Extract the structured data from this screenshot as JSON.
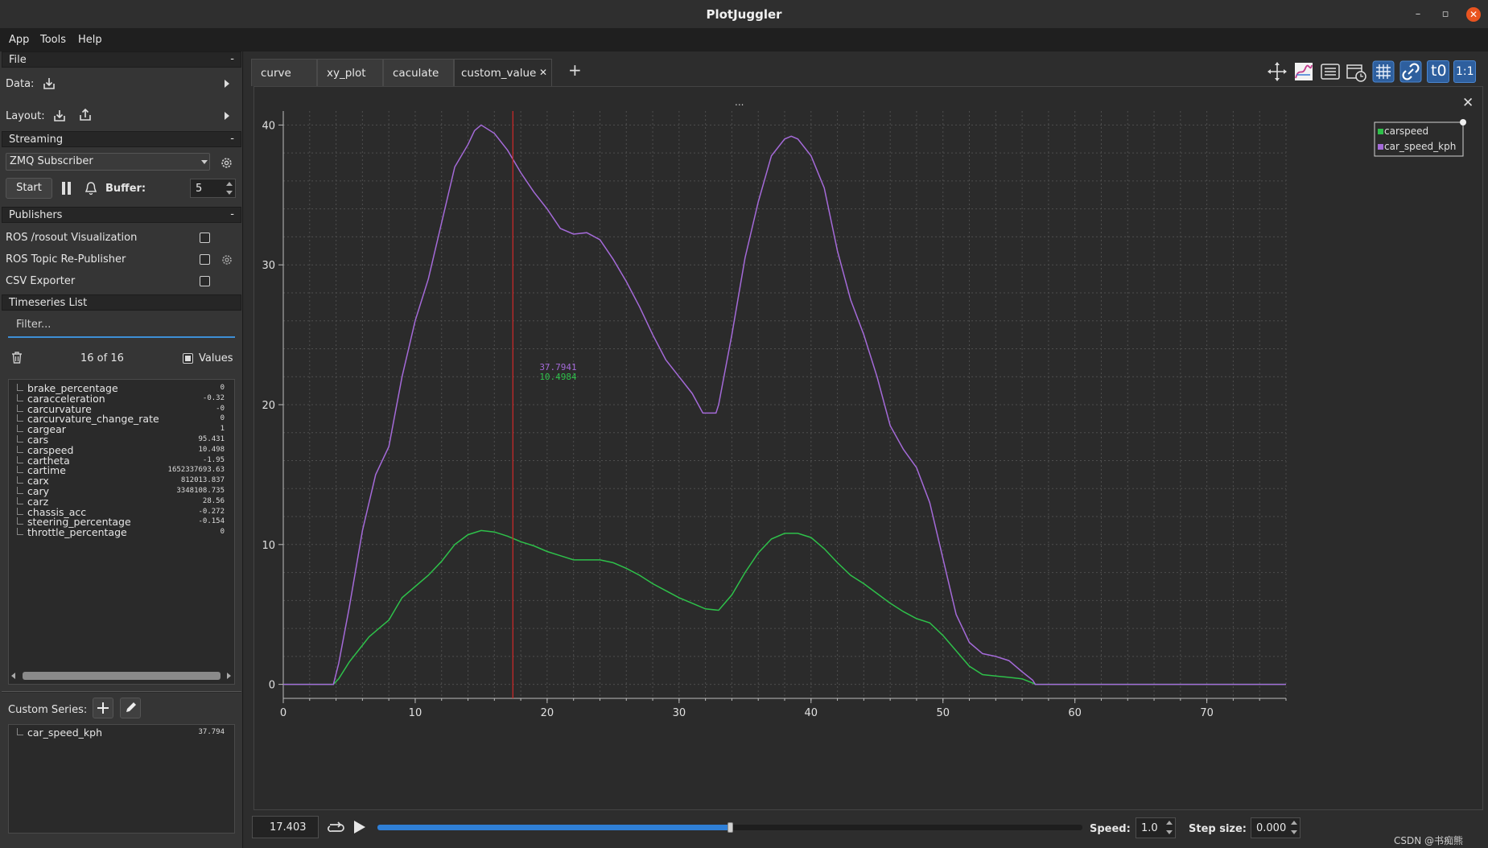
{
  "window": {
    "title": "PlotJuggler",
    "minimize": "–",
    "maximize": "▫",
    "close": "✕"
  },
  "menu": [
    "App",
    "Tools",
    "Help"
  ],
  "left": {
    "file": {
      "header": "File",
      "collapse": "-",
      "data_label": "Data:",
      "layout_label": "Layout:"
    },
    "streaming": {
      "header": "Streaming",
      "collapse": "-",
      "source": "ZMQ Subscriber",
      "start": "Start",
      "buffer_label": "Buffer:",
      "buffer_value": "5"
    },
    "publishers": {
      "header": "Publishers",
      "collapse": "-",
      "items": [
        "ROS /rosout Visualization",
        "ROS Topic Re-Publisher",
        "CSV Exporter"
      ]
    },
    "timeseries": {
      "header": "Timeseries List",
      "filter_placeholder": "Filter...",
      "count": "16 of 16",
      "values_label": "Values",
      "rows": [
        {
          "name": "brake_percentage",
          "value": "0"
        },
        {
          "name": "caracceleration",
          "value": "-0.32"
        },
        {
          "name": "carcurvature",
          "value": "-0"
        },
        {
          "name": "carcurvature_change_rate",
          "value": "0"
        },
        {
          "name": "cargear",
          "value": "1"
        },
        {
          "name": "cars",
          "value": "95.431"
        },
        {
          "name": "carspeed",
          "value": "10.498"
        },
        {
          "name": "cartheta",
          "value": "-1.95"
        },
        {
          "name": "cartime",
          "value": "1652337693.63"
        },
        {
          "name": "carx",
          "value": "812013.837"
        },
        {
          "name": "cary",
          "value": "3348108.735"
        },
        {
          "name": "carz",
          "value": "28.56"
        },
        {
          "name": "chassis_acc",
          "value": "-0.272"
        },
        {
          "name": "steering_percentage",
          "value": "-0.154"
        },
        {
          "name": "throttle_percentage",
          "value": "0"
        }
      ]
    },
    "custom": {
      "label": "Custom Series:",
      "rows": [
        {
          "name": "car_speed_kph",
          "value": "37.794"
        }
      ]
    }
  },
  "tabs": [
    {
      "label": "curve"
    },
    {
      "label": "xy_plot"
    },
    {
      "label": "caculate"
    },
    {
      "label": "custom_value",
      "active": true
    }
  ],
  "tab_close": "✕",
  "tab_add": "+",
  "toolbar_icons": [
    "move-icon",
    "edit-plot-icon",
    "list-icon",
    "clock-icon",
    "grid-icon",
    "link-icon",
    "t0-icon",
    "ratio-icon"
  ],
  "toolbar_text": {
    "t0": "t0",
    "ratio": "1:1"
  },
  "plot": {
    "title_placeholder": "...",
    "close": "✕",
    "tracker": {
      "x": 17.403,
      "v1": "37.7941",
      "v2": "10.4984"
    }
  },
  "chart_data": {
    "type": "line",
    "xlim": [
      0,
      76
    ],
    "ylim": [
      -1,
      41
    ],
    "xticks": [
      0,
      10,
      20,
      30,
      40,
      50,
      60,
      70
    ],
    "yticks": [
      0,
      10,
      20,
      30,
      40
    ],
    "grid": true,
    "legend_position": "top-right",
    "series": [
      {
        "name": "carspeed",
        "color": "#2ec04a",
        "points": [
          [
            0,
            0
          ],
          [
            3.8,
            0
          ],
          [
            4.2,
            0.4
          ],
          [
            5,
            1.6
          ],
          [
            6,
            2.8
          ],
          [
            6.5,
            3.4
          ],
          [
            7.5,
            4.2
          ],
          [
            8,
            4.6
          ],
          [
            8.5,
            5.4
          ],
          [
            9,
            6.2
          ],
          [
            10,
            7.0
          ],
          [
            11,
            7.8
          ],
          [
            12,
            8.8
          ],
          [
            13,
            10.0
          ],
          [
            14,
            10.7
          ],
          [
            15,
            11.0
          ],
          [
            16,
            10.9
          ],
          [
            17,
            10.6
          ],
          [
            18,
            10.2
          ],
          [
            19,
            9.9
          ],
          [
            20,
            9.5
          ],
          [
            21,
            9.2
          ],
          [
            22,
            8.9
          ],
          [
            23,
            8.9
          ],
          [
            24,
            8.9
          ],
          [
            25,
            8.7
          ],
          [
            26,
            8.3
          ],
          [
            27,
            7.8
          ],
          [
            28,
            7.2
          ],
          [
            29,
            6.7
          ],
          [
            30,
            6.2
          ],
          [
            31,
            5.8
          ],
          [
            32,
            5.4
          ],
          [
            33,
            5.3
          ],
          [
            34,
            6.4
          ],
          [
            35,
            8.0
          ],
          [
            36,
            9.4
          ],
          [
            37,
            10.4
          ],
          [
            38,
            10.8
          ],
          [
            39,
            10.8
          ],
          [
            40,
            10.5
          ],
          [
            41,
            9.7
          ],
          [
            42,
            8.7
          ],
          [
            43,
            7.8
          ],
          [
            44,
            7.2
          ],
          [
            45,
            6.5
          ],
          [
            46,
            5.8
          ],
          [
            47,
            5.2
          ],
          [
            48,
            4.7
          ],
          [
            49,
            4.4
          ],
          [
            50,
            3.5
          ],
          [
            51,
            2.4
          ],
          [
            52,
            1.3
          ],
          [
            53,
            0.7
          ],
          [
            54,
            0.6
          ],
          [
            55,
            0.5
          ],
          [
            56,
            0.4
          ],
          [
            56.8,
            0.1
          ],
          [
            57,
            0
          ],
          [
            76,
            0
          ]
        ]
      },
      {
        "name": "car_speed_kph",
        "color": "#a46ad8",
        "points": [
          [
            0,
            0
          ],
          [
            3.8,
            0
          ],
          [
            4.2,
            1.5
          ],
          [
            5,
            5.5
          ],
          [
            6,
            11.0
          ],
          [
            7,
            15.0
          ],
          [
            8,
            17.0
          ],
          [
            9,
            22.0
          ],
          [
            10,
            26.0
          ],
          [
            11,
            29.0
          ],
          [
            12,
            33.0
          ],
          [
            13,
            37.0
          ],
          [
            14,
            38.6
          ],
          [
            14.5,
            39.6
          ],
          [
            15,
            40.0
          ],
          [
            16,
            39.4
          ],
          [
            17,
            38.2
          ],
          [
            18,
            36.6
          ],
          [
            19,
            35.2
          ],
          [
            20,
            34.0
          ],
          [
            21,
            32.6
          ],
          [
            22,
            32.2
          ],
          [
            23,
            32.3
          ],
          [
            24,
            31.8
          ],
          [
            25,
            30.4
          ],
          [
            26,
            28.8
          ],
          [
            27,
            27.0
          ],
          [
            28,
            25.0
          ],
          [
            29,
            23.2
          ],
          [
            30,
            22.0
          ],
          [
            31,
            20.8
          ],
          [
            31.8,
            19.4
          ],
          [
            32.8,
            19.4
          ],
          [
            33,
            20.0
          ],
          [
            34,
            25.0
          ],
          [
            35,
            30.5
          ],
          [
            36,
            34.5
          ],
          [
            37,
            37.8
          ],
          [
            38,
            39.0
          ],
          [
            38.5,
            39.2
          ],
          [
            39,
            39.0
          ],
          [
            40,
            37.8
          ],
          [
            41,
            35.5
          ],
          [
            42,
            31.0
          ],
          [
            43,
            27.5
          ],
          [
            44,
            25.0
          ],
          [
            45,
            22.0
          ],
          [
            46,
            18.5
          ],
          [
            47,
            16.8
          ],
          [
            48,
            15.5
          ],
          [
            49,
            13.0
          ],
          [
            50,
            9.0
          ],
          [
            51,
            5.0
          ],
          [
            52,
            3.0
          ],
          [
            53,
            2.2
          ],
          [
            54,
            2.0
          ],
          [
            55,
            1.7
          ],
          [
            56,
            0.9
          ],
          [
            56.8,
            0.3
          ],
          [
            57,
            0
          ],
          [
            76,
            0
          ]
        ]
      }
    ]
  },
  "bottom": {
    "time_value": "17.403",
    "progress": 0.5,
    "speed_label": "Speed:",
    "speed_value": "1.0",
    "step_label": "Step size:",
    "step_value": "0.000"
  },
  "watermark": "CSDN @书痴熊"
}
